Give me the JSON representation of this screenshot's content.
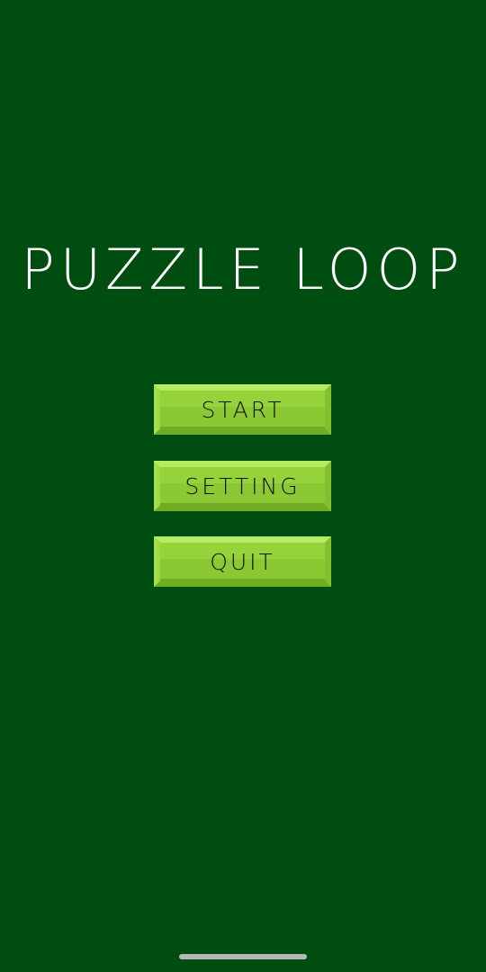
{
  "app": {
    "title": "PUZZLE LOOP"
  },
  "menu": {
    "start_label": "START",
    "setting_label": "SETTING",
    "quit_label": "QUIT"
  },
  "colors": {
    "background": "#004d12",
    "button_face": "#96d33a",
    "button_highlight": "#b6ec63",
    "button_shadow": "#6fad24",
    "title_text": "#ffffff",
    "button_text": "#111111"
  }
}
